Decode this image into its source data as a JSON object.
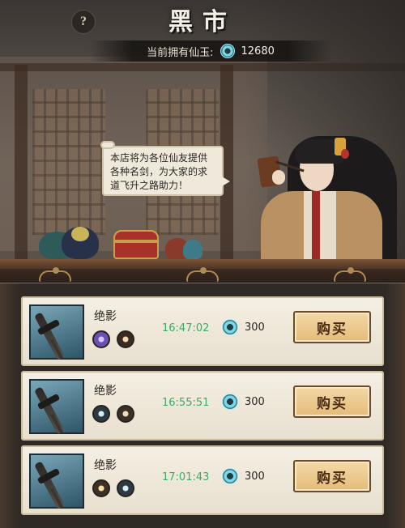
{
  "header": {
    "title": "黑市",
    "help_label": "?",
    "currency_label": "当前拥有仙玉:",
    "currency_value": "12680",
    "currency_icon": "jade-coin-icon"
  },
  "merchant": {
    "speech": "本店将为各位仙友提供各种名剑，为大家的求道飞升之路助力！"
  },
  "items": [
    {
      "name": "绝影",
      "time": "16:47:02",
      "price": "300",
      "buy_label": "购买",
      "gems": [
        "violet-gem-icon",
        "fire-gem-icon"
      ]
    },
    {
      "name": "绝影",
      "time": "16:55:51",
      "price": "300",
      "buy_label": "购买",
      "gems": [
        "water-gem-icon",
        "earth-gem-icon"
      ]
    },
    {
      "name": "绝影",
      "time": "17:01:43",
      "price": "300",
      "buy_label": "购买",
      "gems": [
        "gold-gem-icon",
        "water-gem-icon"
      ]
    }
  ],
  "colors": {
    "timer_green": "#3faa67",
    "jade_cyan": "#7fd6e3",
    "button_gold": "#e4bb78"
  }
}
